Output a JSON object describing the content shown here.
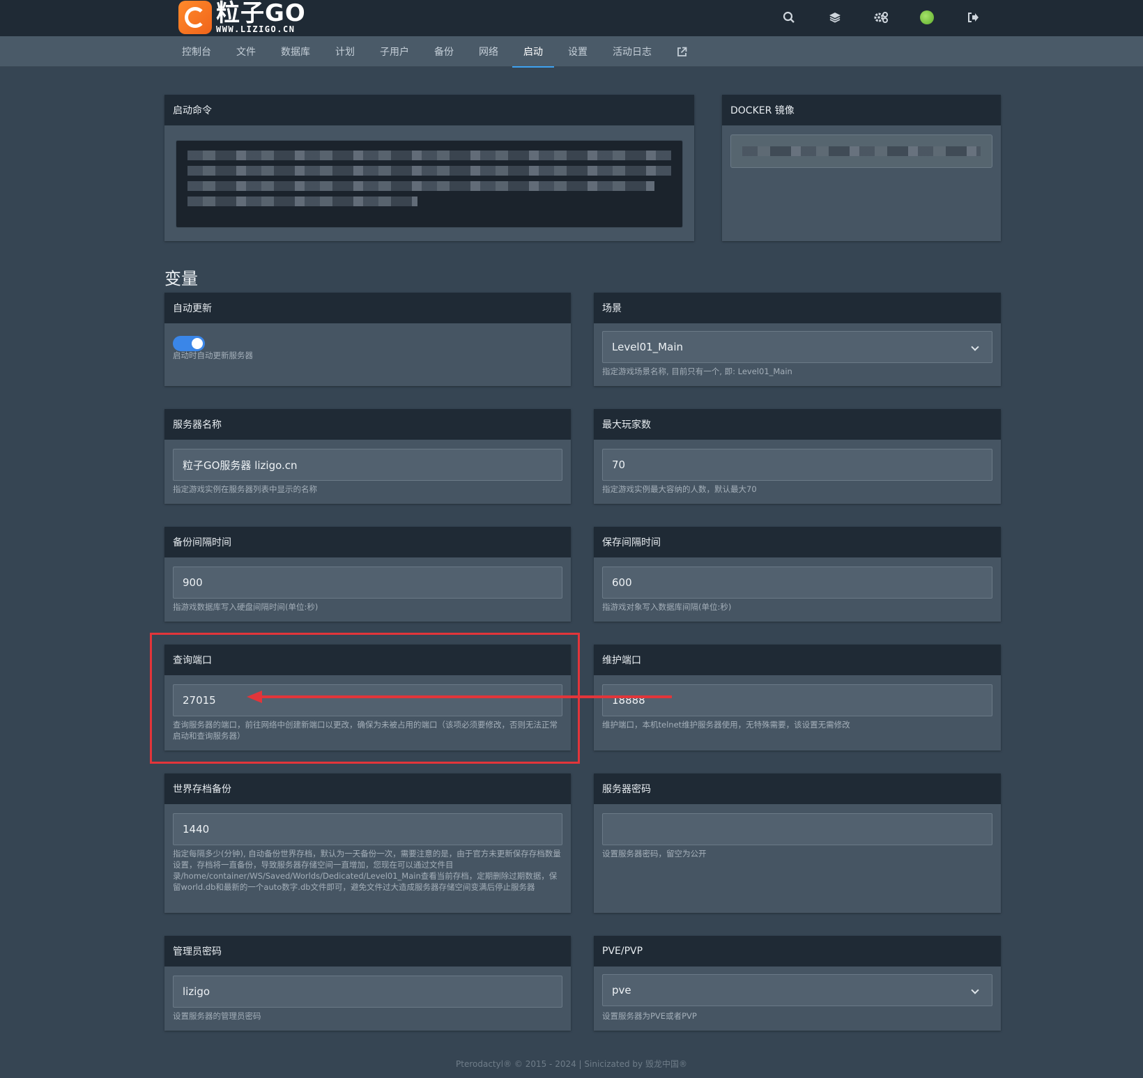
{
  "brand": {
    "title": "粒子GO",
    "subtitle": "WWW.LIZIGO.CN"
  },
  "top_icons": [
    "search-icon",
    "layers-icon",
    "gears-icon",
    "avatar",
    "logout-icon"
  ],
  "nav": {
    "items": [
      "控制台",
      "文件",
      "数据库",
      "计划",
      "子用户",
      "备份",
      "网络",
      "启动",
      "设置",
      "活动日志"
    ],
    "active": "启动"
  },
  "startup": {
    "command_title": "启动命令",
    "docker_title": "DOCKER 镜像"
  },
  "variables_title": "变量",
  "vars": {
    "auto_update": {
      "title": "自动更新",
      "help": "启动时自动更新服务器"
    },
    "scene": {
      "title": "场景",
      "value": "Level01_Main",
      "help": "指定游戏场景名称, 目前只有一个, 即: Level01_Main"
    },
    "server_name": {
      "title": "服务器名称",
      "value": "粒子GO服务器 lizigo.cn",
      "help": "指定游戏实例在服务器列表中显示的名称"
    },
    "max_players": {
      "title": "最大玩家数",
      "value": "70",
      "help": "指定游戏实例最大容纳的人数，默认最大70"
    },
    "backup_interval": {
      "title": "备份间隔时间",
      "value": "900",
      "help": "指游戏数据库写入硬盘间隔时间(单位:秒)"
    },
    "save_interval": {
      "title": "保存间隔时间",
      "value": "600",
      "help": "指游戏对象写入数据库间隔(单位:秒)"
    },
    "query_port": {
      "title": "查询端口",
      "value": "27015",
      "help": "查询服务器的端口，前往网络中创建新端口以更改，确保为未被占用的端口（该项必须要修改，否则无法正常启动和查询服务器）"
    },
    "maint_port": {
      "title": "维护端口",
      "value": "18888",
      "help": "维护端口，本机telnet维护服务器使用，无特殊需要，该设置无需修改"
    },
    "world_backup": {
      "title": "世界存档备份",
      "value": "1440",
      "help": "指定每隔多少(分钟), 自动备份世界存档，默认为一天备份一次，需要注意的是，由于官方未更新保存存档数量设置，存档将一直备份，导致服务器存储空间一直增加，您现在可以通过文件目录/home/container/WS/Saved/Worlds/Dedicated/Level01_Main查看当前存档，定期删除过期数据，保留world.db和最新的一个auto数字.db文件即可，避免文件过大造成服务器存储空间变满后停止服务器"
    },
    "server_password": {
      "title": "服务器密码",
      "value": "",
      "help": "设置服务器密码，留空为公开"
    },
    "admin_password": {
      "title": "管理员密码",
      "value": "lizigo",
      "help": "设置服务器的管理员密码"
    },
    "pve_pvp": {
      "title": "PVE/PVP",
      "value": "pve",
      "help": "设置服务器为PVE或者PVP"
    }
  },
  "footer": "Pterodactyl® © 2015 - 2024 | Sinicizated by 毁龙中国®",
  "colors": {
    "accent": "#3ea2f0",
    "highlight": "#e2353a",
    "toggle": "#3a86e8"
  }
}
